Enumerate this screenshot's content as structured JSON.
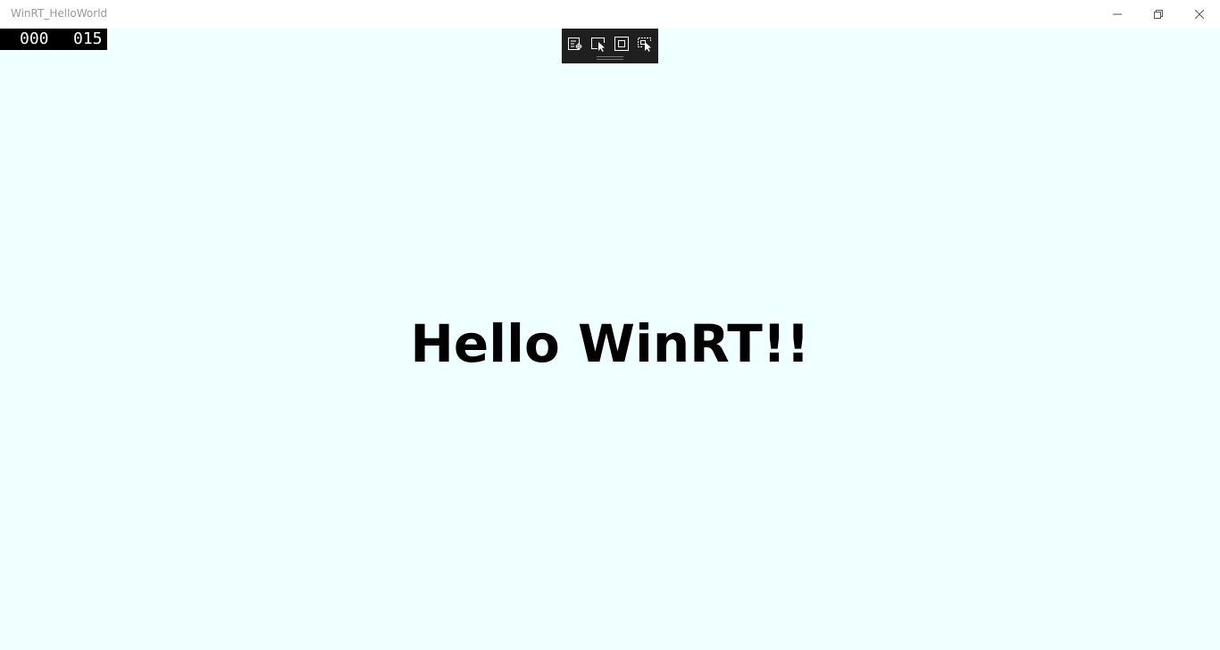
{
  "window": {
    "title": "WinRT_HelloWorld",
    "icons": {
      "minimize": "minimize-icon",
      "restore": "restore-icon",
      "close": "close-icon"
    }
  },
  "frame_counter": {
    "left": "000",
    "right": "015"
  },
  "debug_toolbar": {
    "icons": [
      "live-visual-tree-icon",
      "select-element-icon",
      "display-layout-adorners-icon",
      "track-focused-element-icon"
    ]
  },
  "main": {
    "heading": "Hello WinRT!!"
  },
  "colors": {
    "background": "#f0ffff",
    "text": "#000000",
    "toolbar": "#1f1f1f",
    "title": "#999999"
  }
}
